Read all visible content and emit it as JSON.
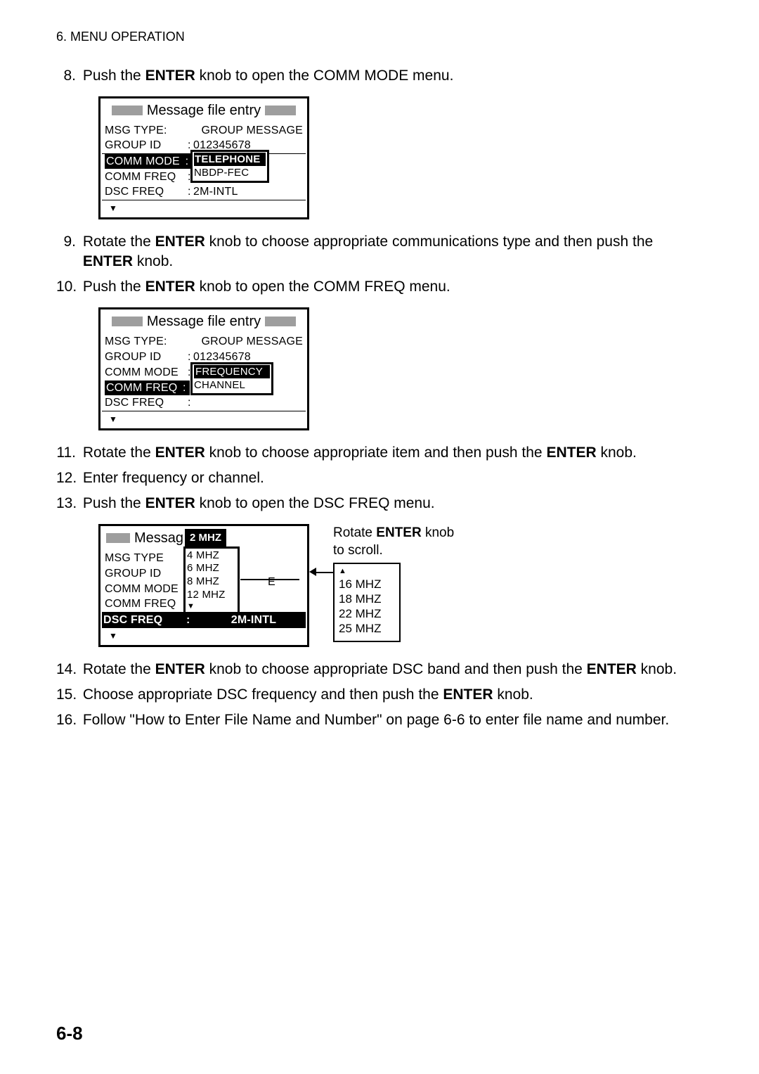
{
  "header": "6. MENU OPERATION",
  "page_num": "6-8",
  "steps": {
    "s8": {
      "num": "8.",
      "prefix": "Push the ",
      "bold": "ENTER",
      "suffix": " knob to open the COMM MODE menu."
    },
    "s9": {
      "num": "9.",
      "prefix": "Rotate the ",
      "bold1": "ENTER",
      "mid": " knob to choose appropriate communications type and then push the ",
      "bold2": "ENTER",
      "suffix": " knob."
    },
    "s10": {
      "num": "10.",
      "prefix": "Push the ",
      "bold": "ENTER",
      "suffix": " knob to open the COMM FREQ menu."
    },
    "s11": {
      "num": "11.",
      "prefix": "Rotate the ",
      "bold1": "ENTER",
      "mid": " knob to choose appropriate item and then push the ",
      "bold2": "ENTER",
      "suffix": " knob."
    },
    "s12": {
      "num": "12.",
      "text": "Enter frequency or channel."
    },
    "s13": {
      "num": "13.",
      "prefix": "Push the ",
      "bold": "ENTER",
      "suffix": " knob to open the DSC FREQ menu."
    },
    "s14": {
      "num": "14.",
      "prefix": "Rotate the ",
      "bold1": "ENTER",
      "mid": " knob to choose appropriate DSC band and then push the ",
      "bold2": "ENTER",
      "suffix": " knob."
    },
    "s15": {
      "num": "15.",
      "prefix": "Choose appropriate DSC frequency and then push the ",
      "bold": "ENTER",
      "suffix": " knob."
    },
    "s16": {
      "num": "16.",
      "text": "Follow \"How to Enter File Name and Number\" on page 6-6 to enter file name and number."
    }
  },
  "lcd1": {
    "title": "Message file entry",
    "rows": {
      "msg_type": {
        "label": "MSG  TYPE:",
        "value": "GROUP MESSAGE"
      },
      "group_id": {
        "label": "GROUP ID",
        "colon": ":",
        "value": "012345678"
      },
      "comm_mode": {
        "label": "COMM MODE",
        "colon": ":",
        "value": "TELEPHONE"
      },
      "comm_freq": {
        "label": "COMM FREQ",
        "colon": ":"
      },
      "dsc_freq": {
        "label": "DSC  FREQ",
        "colon": ":",
        "value": "2M-INTL"
      }
    },
    "popup": {
      "opt1": "TELEPHONE",
      "opt2": "NBDP-FEC"
    }
  },
  "lcd2": {
    "title": "Message file entry",
    "rows": {
      "msg_type": {
        "label": "MSG  TYPE:",
        "value": "GROUP MESSAGE"
      },
      "group_id": {
        "label": "GROUP ID",
        "colon": ":",
        "value": "012345678"
      },
      "comm_mode": {
        "label": "COMM MODE",
        "colon": ":"
      },
      "comm_freq": {
        "label": "COMM FREQ",
        "colon": ":"
      },
      "dsc_freq": {
        "label": "DSC  FREQ",
        "colon": ":"
      }
    },
    "popup": {
      "opt1": "FREQUENCY",
      "opt2": "CHANNEL"
    }
  },
  "lcd3": {
    "title_cut": "Messag",
    "rows": {
      "msg_type": {
        "label": "MSG  TYPE"
      },
      "group_id": {
        "label": "GROUP ID"
      },
      "comm_mode": {
        "label": "COMM MODE"
      },
      "comm_freq": {
        "label": "COMM FREQ"
      },
      "dsc_freq": {
        "label": "DSC  FREQ",
        "colon": ":",
        "value": "2M-INTL"
      }
    },
    "list_top": "2 MHZ",
    "list": {
      "l1": "4 MHZ",
      "l2": "6 MHZ",
      "l3": "8 MHZ",
      "l4": "12 MHZ"
    },
    "e_letter": "E"
  },
  "scroll_label": {
    "prefix": "Rotate ",
    "bold": "ENTER",
    "suffix": " knob",
    "line2": "to scroll."
  },
  "scroll_box": {
    "l1": "16 MHZ",
    "l2": "18 MHZ",
    "l3": "22 MHZ",
    "l4": "25 MHZ"
  }
}
